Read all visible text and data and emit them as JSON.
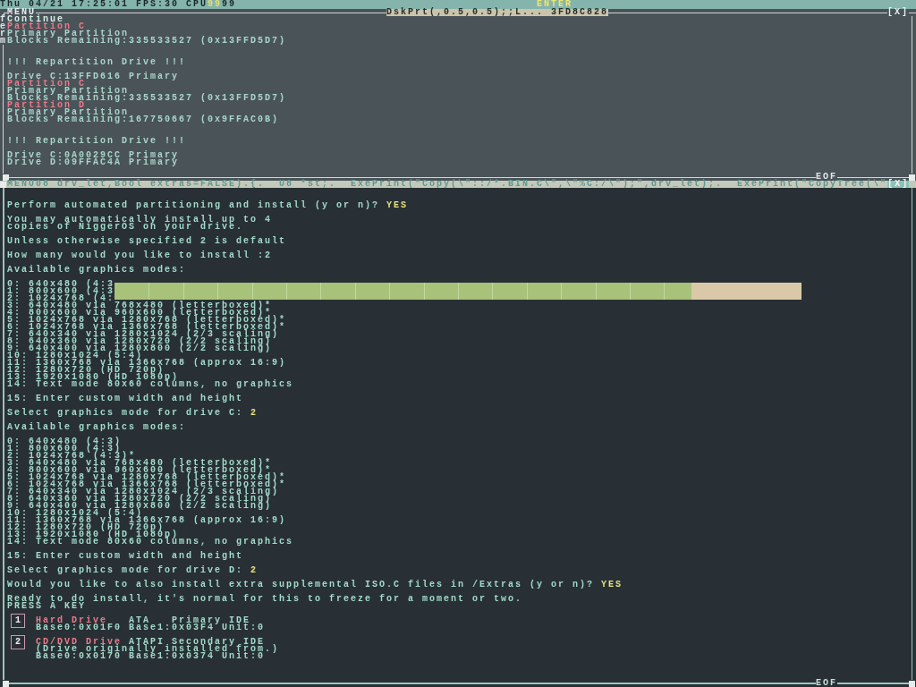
{
  "status_bar": {
    "clock": "Thu 04/21 17:25:01",
    "fps": "FPS:30",
    "cpu_label": "CPU",
    "cpu_cores": [
      {
        "value": "99",
        "color": "#e8dc6c"
      },
      {
        "value": "99",
        "color": "#1c2828"
      }
    ],
    "key_hint": "ENTER"
  },
  "top_window": {
    "menu_label": "MENU",
    "task_title": "DskPrt(,0.5,0.5);;L...",
    "task_address": "3FD8C828",
    "close": "[X]",
    "edge_chars": [
      "f",
      "e",
      "r",
      "m"
    ],
    "lines": [
      {
        "kind": "menu",
        "text": "Continue"
      },
      {
        "kind": "partition",
        "text": "Partition C"
      },
      {
        "kind": "text",
        "text": "Primary Partition"
      },
      {
        "kind": "text",
        "text": "Blocks Remaining:335533527 (0x13FFD5D7)"
      },
      {
        "kind": "heading",
        "text": "!!! Repartition Drive !!!"
      },
      {
        "kind": "text",
        "text": "Drive C:13FFD616 Primary"
      },
      {
        "kind": "partition",
        "text": "Partition C"
      },
      {
        "kind": "text",
        "text": "Primary Partition"
      },
      {
        "kind": "text",
        "text": "Blocks Remaining:335533527 (0x13FFD5D7)"
      },
      {
        "kind": "partition",
        "text": "Partition D"
      },
      {
        "kind": "text",
        "text": "Primary Partition"
      },
      {
        "kind": "text",
        "text": "Blocks Remaining:167750667 (0x9FFAC0B)"
      },
      {
        "kind": "heading",
        "text": "!!! Repartition Drive !!!"
      },
      {
        "kind": "text",
        "text": "Drive C:0A0029CC Primary"
      },
      {
        "kind": "text",
        "text": "Drive D:09FFAC4A Primary"
      }
    ],
    "eof": "EOF"
  },
  "console_window": {
    "title": "MENU08 drv_let,Bool extras=FALSE).{.  U8 *st;.  ExePrint(\"Copy(\\\"::/*.BIN.C\\\",\\\"%C:/\\\");\",drv_let);.  ExePrint(\"CopyTree(\\\"",
    "close": "[X]",
    "blocks": [
      {
        "kind": "prompt",
        "text": "Perform automated partitioning and install (y or n)?",
        "answer": "YES"
      },
      {
        "kind": "text",
        "lines": [
          "You may automatically install up to 4",
          "copies of NiggerOS on your drive."
        ]
      },
      {
        "kind": "text",
        "lines": [
          "Unless otherwise specified 2 is default"
        ]
      },
      {
        "kind": "text",
        "lines": [
          "How many would you like to install :2"
        ]
      },
      {
        "kind": "text",
        "lines": [
          "Available graphics modes:"
        ]
      },
      {
        "kind": "options",
        "lines": [
          "0: 640x480 (4:3",
          "1: 800x600 (4:3",
          "2: 1024x768 (4:",
          "3: 640x480 via 768x480 (letterboxed)*",
          "4: 800x600 via 960x600 (letterboxed)*",
          "5: 1024x768 via 1280x768 (letterboxed)*",
          "6: 1024x768 via 1366x768 (letterboxed)*",
          "7: 640x340 via 1280x1024 (2/3 scaling)",
          "8: 640x360 via 1280x720 (2/2 scaling)",
          "9: 640x400 via 1280x800 (2/2 scaling)",
          "10: 1280x1024 (5:4)",
          "11: 1360x768 via 1366x768 (approx 16:9)",
          "12: 1280x720 (HD 720p)",
          "13: 1920x1080 (HD 1080p)",
          "14: Text mode 80x60 columns, no graphics"
        ]
      },
      {
        "kind": "options",
        "lines": [
          "15: Enter custom width and height"
        ]
      },
      {
        "kind": "prompt",
        "text": "Select graphics mode for drive C:",
        "answer": "2"
      },
      {
        "kind": "text",
        "lines": [
          "Available graphics modes:"
        ]
      },
      {
        "kind": "options",
        "lines": [
          "0: 640x480 (4:3)",
          "1: 800x600 (4:3)",
          "2: 1024x768 (4:3)*",
          "3: 640x480 via 768x480 (letterboxed)*",
          "4: 800x600 via 960x600 (letterboxed)*",
          "5: 1024x768 via 1280x768 (letterboxed)*",
          "6: 1024x768 via 1366x768 (letterboxed)*",
          "7: 640x340 via 1280x1024 (2/3 scaling)",
          "8: 640x360 via 1280x720 (2/2 scaling)",
          "9: 640x400 via 1280x800 (2/2 scaling)",
          "10: 1280x1024 (5:4)",
          "11: 1360x768 via 1366x768 (approx 16:9)",
          "12: 1280x720 (HD 720p)",
          "13: 1920x1080 (HD 1080p)",
          "14: Text mode 80x60 columns, no graphics"
        ]
      },
      {
        "kind": "options",
        "lines": [
          "15: Enter custom width and height"
        ]
      },
      {
        "kind": "prompt",
        "text": "Select graphics mode for drive D:",
        "answer": "2"
      },
      {
        "kind": "prompt",
        "text": "Would you like to also install extra supplemental ISO.C files in /Extras (y or n)?",
        "answer": "YES"
      },
      {
        "kind": "text",
        "lines": [
          "Ready to do install, it's normal for this to freeze for a moment or two.",
          "PRESS A KEY"
        ]
      }
    ],
    "drives": [
      {
        "number": "1",
        "name": "Hard Drive",
        "type": "ATA",
        "port": "Primary IDE",
        "details": [
          "Base0:0x01F0 Base1:0x03F4 Unit:0"
        ]
      },
      {
        "number": "2",
        "name": "CD/DVD Drive",
        "type": "ATAPI",
        "port": "Secondary IDE",
        "details": [
          "(Drive originally installed from.)",
          "Base0:0x0170 Base1:0x0374 Unit:0"
        ]
      }
    ],
    "progress": {
      "level": 0.84
    },
    "eof": "EOF"
  }
}
